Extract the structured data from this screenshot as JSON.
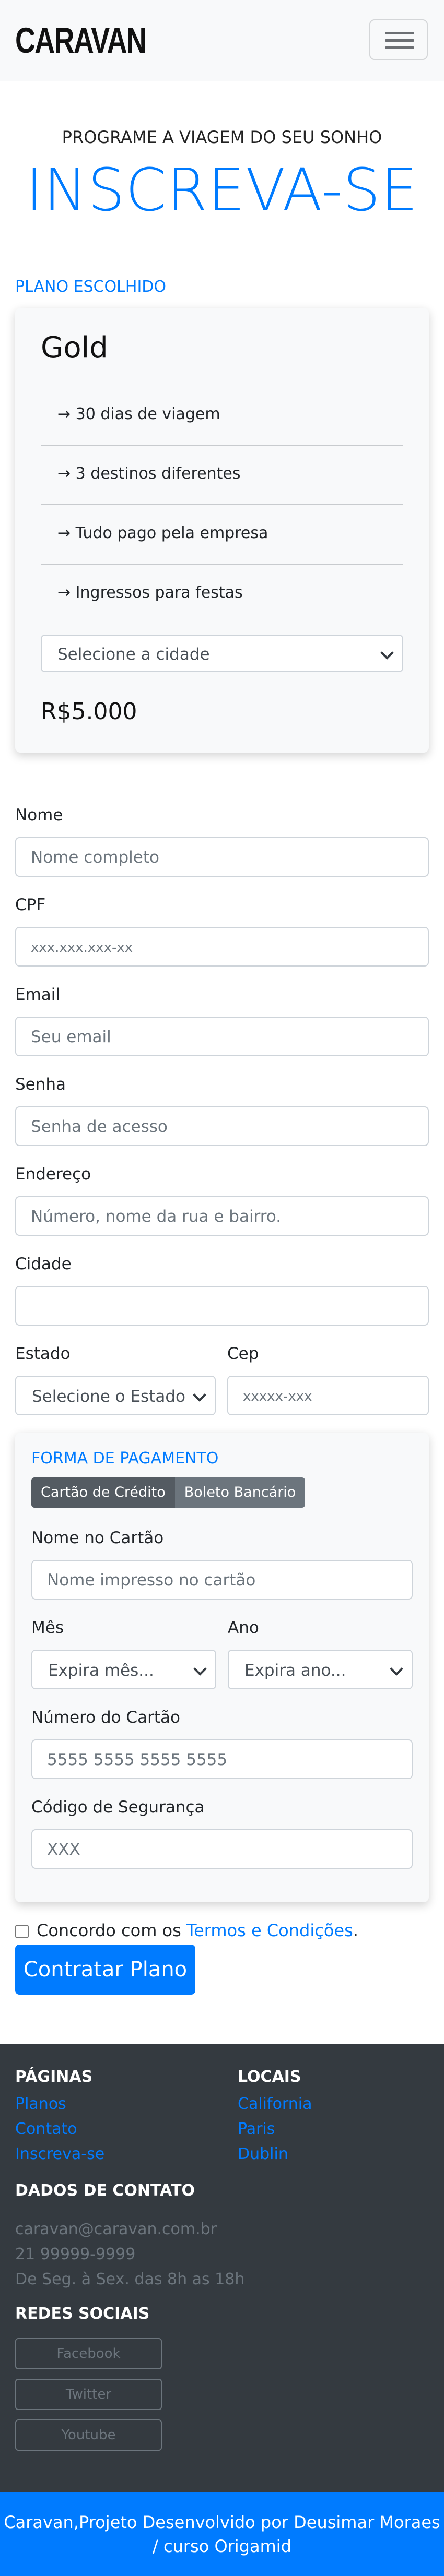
{
  "navbar": {
    "brand": "CARAVAN",
    "toggle_icon": "hamburger-menu-icon"
  },
  "hero": {
    "subtitle": "PROGRAME A VIAGEM DO SEU SONHO",
    "title": "INSCREVA-SE"
  },
  "plan": {
    "section_label": "PLANO ESCOLHIDO",
    "name": "Gold",
    "features": [
      "→ 30 dias de viagem",
      "→ 3 destinos diferentes",
      "→ Tudo pago pela empresa",
      "→ Ingressos para festas"
    ],
    "city_select": "Selecione a cidade",
    "price": "R$5.000"
  },
  "form": {
    "nome": {
      "label": "Nome",
      "placeholder": "Nome completo"
    },
    "cpf": {
      "label": "CPF",
      "placeholder": "xxx.xxx.xxx-xx"
    },
    "email": {
      "label": "Email",
      "placeholder": "Seu email"
    },
    "senha": {
      "label": "Senha",
      "placeholder": "Senha de acesso"
    },
    "endereco": {
      "label": "Endereço",
      "placeholder": "Número, nome da rua e bairro."
    },
    "cidade": {
      "label": "Cidade",
      "placeholder": ""
    },
    "estado": {
      "label": "Estado",
      "selected": "Selecione o Estado"
    },
    "cep": {
      "label": "Cep",
      "placeholder": "xxxxx-xxx"
    }
  },
  "payment": {
    "title": "FORMA DE PAGAMENTO",
    "options": [
      "Cartão de Crédito",
      "Boleto Bancário"
    ],
    "card_name": {
      "label": "Nome no Cartão",
      "placeholder": "Nome impresso no cartão"
    },
    "month": {
      "label": "Mês",
      "selected": "Expira mês..."
    },
    "year": {
      "label": "Ano",
      "selected": "Expira ano..."
    },
    "card_number": {
      "label": "Número do Cartão",
      "placeholder": "5555 5555 5555 5555"
    },
    "security_code": {
      "label": "Código de Segurança",
      "placeholder": "XXX"
    }
  },
  "terms": {
    "prefix": "Concordo com os ",
    "link": "Termos e Condições",
    "suffix": "."
  },
  "submit_label": "Contratar Plano",
  "footer": {
    "pages_title": "PÁGINAS",
    "pages": [
      "Planos",
      "Contato",
      "Inscreva-se"
    ],
    "locations_title": "LOCAIS",
    "locations": [
      "California",
      "Paris",
      "Dublin"
    ],
    "contact_title": "DADOS DE CONTATO",
    "contact": [
      "caravan@caravan.com.br",
      "21 99999-9999",
      "De Seg. à Sex. das 8h as 18h"
    ],
    "social_title": "REDES SOCIAIS",
    "social": [
      "Facebook",
      "Twitter",
      "Youtube"
    ]
  },
  "bottom_text": "Caravan,Projeto Desenvolvido por Deusimar Moraes / curso Origamid",
  "colors": {
    "primary": "#007bff",
    "dark": "#343a40",
    "light": "#f8f9fa"
  }
}
